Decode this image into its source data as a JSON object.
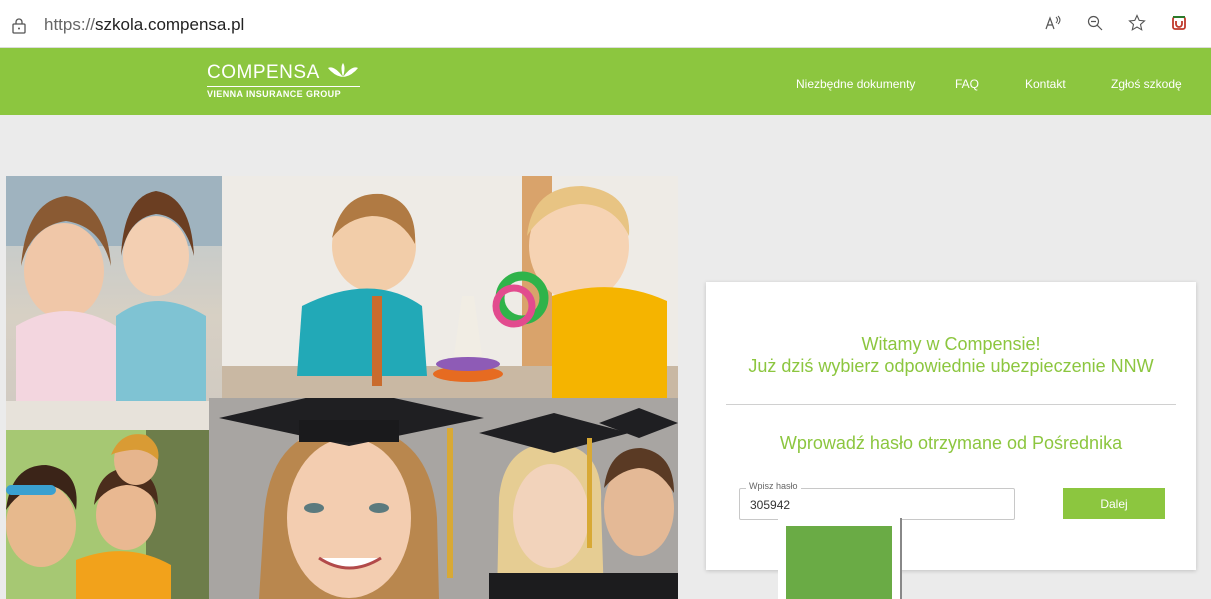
{
  "browser": {
    "url_protocol": "https://",
    "url_host": "szkola.compensa.pl",
    "icons": [
      "lock-icon",
      "read-aloud-icon",
      "zoom-out-icon",
      "favorite-star-icon",
      "extension-icon"
    ]
  },
  "header": {
    "logo_text": "COMPENSA",
    "logo_subtitle": "VIENNA INSURANCE GROUP",
    "nav": [
      {
        "label": "Niezbędne dokumenty"
      },
      {
        "label": "FAQ"
      },
      {
        "label": "Kontakt"
      },
      {
        "label": "Zgłoś szkodę"
      }
    ]
  },
  "card": {
    "welcome_line1": "Witamy w Compensie!",
    "welcome_line2": "Już dziś wybierz odpowiednie ubezpieczenie NNW",
    "prompt": "Wprowadź hasło otrzymane od Pośrednika",
    "password_label": "Wpisz hasło",
    "password_value": "305942",
    "submit_label": "Dalej"
  },
  "colors": {
    "brand_green": "#8cc63f",
    "overlay_green": "#6aab45"
  }
}
